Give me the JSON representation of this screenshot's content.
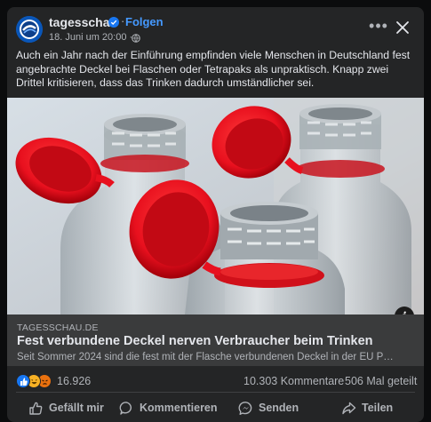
{
  "post": {
    "page_name": "tagesschau",
    "separator": "·",
    "follow_label": "Folgen",
    "timestamp": "18. Juni um 20:00 ·",
    "text": "Auch ein Jahr nach der Einführung empfinden viele Menschen in Deutschland fest angebrachte Deckel bei Flaschen oder Tetrapaks als unpraktisch. Knapp zwei Drittel kritisieren, dass das Trinken dadurch umständlicher sei.",
    "more_label": "•••",
    "info_label": "i"
  },
  "link": {
    "domain": "TAGESSCHAU.DE",
    "title": "Fest verbundene Deckel nerven Verbraucher beim Trinken",
    "description": "Seit Sommer 2024 sind die fest mit der Flasche verbundenen Deckel in der EU P…"
  },
  "stats": {
    "reactions": "16.926",
    "comments": "10.303 Kommentare",
    "shares": "506 Mal geteilt"
  },
  "actions": {
    "like": "Gefällt mir",
    "comment": "Kommentieren",
    "send": "Senden",
    "share": "Teilen"
  },
  "icons": {
    "avatar": "tagesschau-logo-icon",
    "verified": "verified-badge-icon",
    "audience": "globe-icon",
    "close": "close-icon",
    "like": "thumbs-up-icon",
    "comment": "speech-bubble-icon",
    "send": "messenger-icon",
    "share": "share-arrow-icon",
    "info": "info-icon"
  },
  "colors": {
    "card_bg": "#242526",
    "link_accent": "#4599ff",
    "like_blue": "#1877f2",
    "haha_yellow": "#f7b125",
    "angry_red": "#e9710f",
    "cap_red": "#e8101e"
  }
}
